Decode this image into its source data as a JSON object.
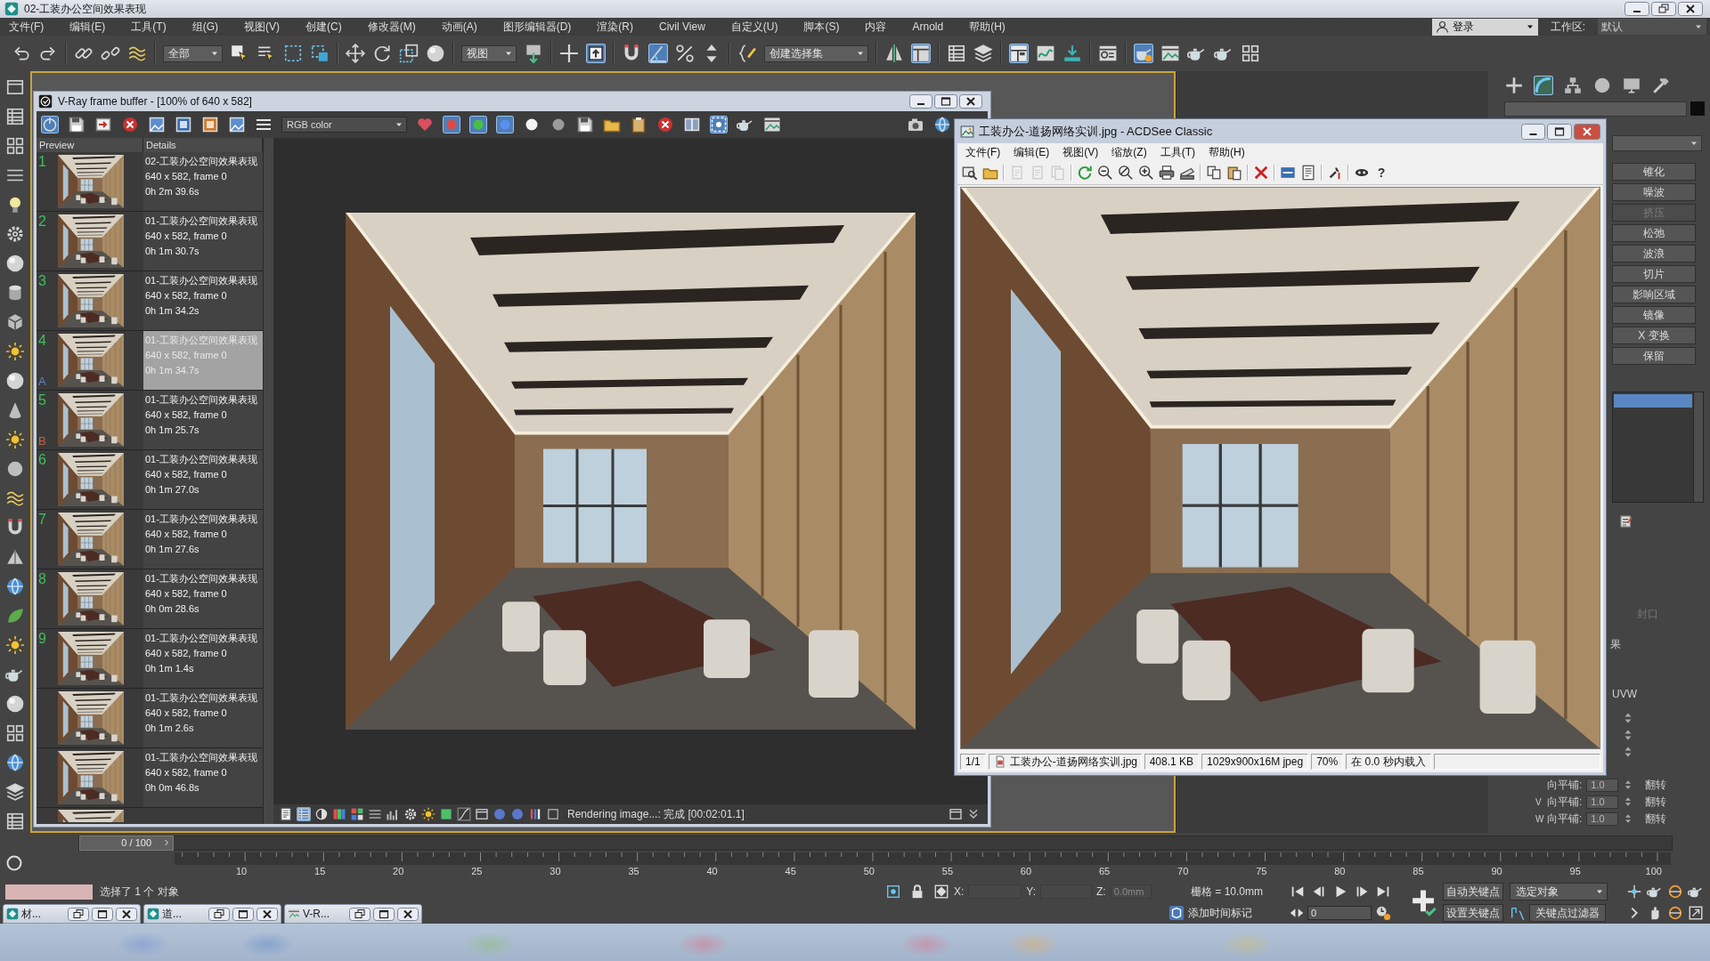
{
  "app": {
    "title": "02-工装办公空间效果表现"
  },
  "menu": [
    "文件(F)",
    "编辑(E)",
    "工具(T)",
    "组(G)",
    "视图(V)",
    "创建(C)",
    "修改器(M)",
    "动画(A)",
    "图形编辑器(D)",
    "渲染(R)",
    "Civil View",
    "自定义(U)",
    "脚本(S)",
    "内容",
    "Arnold",
    "帮助(H)"
  ],
  "account": {
    "label": "登录"
  },
  "workspace": {
    "label": "工作区:",
    "value": "默认"
  },
  "toolbar": {
    "items": [
      {
        "kind": "icon",
        "active": false
      },
      {
        "kind": "icon",
        "active": false
      },
      {
        "kind": "icon",
        "active": false
      },
      {
        "kind": "icon",
        "active": false
      },
      {
        "kind": "icon",
        "active": false
      },
      {
        "kind": "dropdown",
        "value": "全部"
      },
      {
        "kind": "icon",
        "active": false
      },
      {
        "kind": "icon",
        "active": false
      },
      {
        "kind": "icon",
        "active": false
      },
      {
        "kind": "icon",
        "active": false
      },
      {
        "kind": "icon",
        "active": false
      },
      {
        "kind": "icon",
        "active": false
      },
      {
        "kind": "icon",
        "active": false
      },
      {
        "kind": "icon",
        "active": false
      },
      {
        "kind": "dropdown",
        "value": "视图"
      },
      {
        "kind": "icon",
        "active": false
      },
      {
        "kind": "icon",
        "active": false
      },
      {
        "kind": "icon",
        "active": true
      },
      {
        "kind": "icon",
        "active": false
      },
      {
        "kind": "icon",
        "active": true
      },
      {
        "kind": "icon",
        "active": false
      },
      {
        "kind": "icon",
        "active": false
      },
      {
        "kind": "icon",
        "active": false
      },
      {
        "kind": "dropdown",
        "value": "创建选择集"
      },
      {
        "kind": "icon",
        "active": false
      },
      {
        "kind": "icon",
        "active": true
      },
      {
        "kind": "icon",
        "active": false
      },
      {
        "kind": "icon",
        "active": false
      },
      {
        "kind": "icon",
        "active": true
      },
      {
        "kind": "icon",
        "active": false
      },
      {
        "kind": "icon",
        "active": false
      },
      {
        "kind": "icon",
        "active": false
      },
      {
        "kind": "icon",
        "active": true
      },
      {
        "kind": "icon",
        "active": false
      },
      {
        "kind": "icon",
        "active": false
      },
      {
        "kind": "icon",
        "active": false
      },
      {
        "kind": "icon",
        "active": false
      }
    ]
  },
  "vray": {
    "title": "V-Ray frame buffer - [100% of 640 x 582]",
    "toolbar": [
      {
        "kind": "icon",
        "active": true
      },
      {
        "kind": "icon",
        "active": false
      },
      {
        "kind": "icon",
        "active": false
      },
      {
        "kind": "icon",
        "active": false
      },
      {
        "kind": "icon",
        "active": false
      },
      {
        "kind": "icon",
        "active": false
      },
      {
        "kind": "icon",
        "active": false
      },
      {
        "kind": "icon",
        "active": false
      },
      {
        "kind": "icon",
        "active": false
      },
      {
        "kind": "dropdown",
        "value": "RGB color"
      },
      {
        "kind": "icon",
        "active": false
      },
      {
        "kind": "icon",
        "active": true
      },
      {
        "kind": "icon",
        "active": true
      },
      {
        "kind": "icon",
        "active": true
      },
      {
        "kind": "icon",
        "active": false
      },
      {
        "kind": "icon",
        "active": false
      },
      {
        "kind": "icon",
        "active": false
      },
      {
        "kind": "icon",
        "active": false
      },
      {
        "kind": "icon",
        "active": false
      },
      {
        "kind": "icon",
        "active": false
      },
      {
        "kind": "icon",
        "active": false
      },
      {
        "kind": "icon",
        "active": true
      },
      {
        "kind": "icon",
        "active": false
      },
      {
        "kind": "icon",
        "active": false
      },
      {
        "kind": "icon",
        "active": false
      },
      {
        "kind": "icon",
        "active": false
      }
    ],
    "columns": [
      "Preview",
      "Details"
    ],
    "history": [
      {
        "number": "1",
        "name": "02-工装办公空间效果表现",
        "size": "640 x 582, frame 0",
        "time": "0h 2m 39.6s",
        "selected": false
      },
      {
        "number": "2",
        "name": "01-工装办公空间效果表现",
        "size": "640 x 582, frame 0",
        "time": "0h 1m 30.7s",
        "selected": false
      },
      {
        "number": "3",
        "name": "01-工装办公空间效果表现",
        "size": "640 x 582, frame 0",
        "time": "0h 1m 34.2s",
        "selected": false
      },
      {
        "number": "4",
        "name": "01-工装办公空间效果表现",
        "size": "640 x 582, frame 0",
        "time": "0h 1m 34.7s",
        "selected": true,
        "marker": "A"
      },
      {
        "number": "5",
        "name": "01-工装办公空间效果表现",
        "size": "640 x 582, frame 0",
        "time": "0h 1m 25.7s",
        "selected": false,
        "marker": "B"
      },
      {
        "number": "6",
        "name": "01-工装办公空间效果表现",
        "size": "640 x 582, frame 0",
        "time": "0h 1m 27.0s",
        "selected": false
      },
      {
        "number": "7",
        "name": "01-工装办公空间效果表现",
        "size": "640 x 582, frame 0",
        "time": "0h 1m 27.6s",
        "selected": false
      },
      {
        "number": "8",
        "name": "01-工装办公空间效果表现",
        "size": "640 x 582, frame 0",
        "time": "0h 0m 28.6s",
        "selected": false
      },
      {
        "number": "9",
        "name": "01-工装办公空间效果表现",
        "size": "640 x 582, frame 0",
        "time": "0h 1m 1.4s",
        "selected": false
      },
      {
        "name": "01-工装办公空间效果表现",
        "size": "640 x 582, frame 0",
        "time": "0h 1m 2.6s",
        "selected": false
      },
      {
        "name": "01-工装办公空间效果表现",
        "size": "640 x 582, frame 0",
        "time": "0h 0m 46.8s",
        "selected": false
      }
    ],
    "bottom_tools": [
      {
        "active": false
      },
      {
        "active": true
      },
      {
        "active": false
      },
      {
        "active": false
      },
      {
        "active": false
      },
      {
        "active": false
      },
      {
        "active": false
      },
      {
        "active": false
      },
      {
        "active": false
      },
      {
        "active": false
      },
      {
        "active": false
      },
      {
        "active": false
      },
      {
        "active": false
      },
      {
        "active": false
      },
      {
        "active": false
      },
      {
        "active": false
      },
      {
        "active": false
      },
      {
        "active": false
      }
    ],
    "status": "Rendering image...: 完成 [00:02:01.1]"
  },
  "acdsee": {
    "title": "工装办公-道扬网络实训.jpg - ACDSee Classic",
    "menu": [
      "文件(F)",
      "编辑(E)",
      "视图(V)",
      "缩放(Z)",
      "工具(T)",
      "帮助(H)"
    ],
    "toolbar": [
      {
        "kind": "icon",
        "disabled": false
      },
      {
        "kind": "icon",
        "disabled": false
      },
      {
        "kind": "icon",
        "disabled": true
      },
      {
        "kind": "icon",
        "disabled": true
      },
      {
        "kind": "icon",
        "disabled": true
      },
      {
        "kind": "icon",
        "disabled": false
      },
      {
        "kind": "icon",
        "disabled": false
      },
      {
        "kind": "icon",
        "disabled": false
      },
      {
        "kind": "icon",
        "disabled": false
      },
      {
        "kind": "icon",
        "disabled": false
      },
      {
        "kind": "icon",
        "disabled": false
      },
      {
        "kind": "icon",
        "disabled": false
      },
      {
        "kind": "icon",
        "disabled": false
      },
      {
        "kind": "icon",
        "disabled": false
      },
      {
        "kind": "icon",
        "disabled": false
      },
      {
        "kind": "icon",
        "disabled": false
      },
      {
        "kind": "icon",
        "disabled": false
      },
      {
        "kind": "icon",
        "disabled": false
      },
      {
        "kind": "label",
        "label": "?"
      }
    ],
    "status": {
      "index": "1/1",
      "file": "工装办公-道扬网络实训.jpg",
      "size": "408.1 KB",
      "format": "1029x900x16M jpeg",
      "zoom": "70%",
      "load_time": "在 0.0 秒内载入"
    }
  },
  "command_panel": {
    "tabs": [
      {
        "active": false
      },
      {
        "active": true
      },
      {
        "active": false
      },
      {
        "active": false
      },
      {
        "active": false
      },
      {
        "active": false
      }
    ],
    "modifier_buttons": [
      {
        "label": "锥化",
        "disabled": false
      },
      {
        "label": "噪波",
        "disabled": false
      },
      {
        "label": "挤压",
        "disabled": true
      },
      {
        "label": "松弛",
        "disabled": false
      },
      {
        "label": "波浪",
        "disabled": false
      },
      {
        "label": "切片",
        "disabled": false
      },
      {
        "label": "影响区域",
        "disabled": false
      },
      {
        "label": "镜像",
        "disabled": false
      },
      {
        "label": "X 变换",
        "disabled": false
      },
      {
        "label": "保留",
        "disabled": false
      }
    ],
    "cap": {
      "label": "封口",
      "disabled": true
    },
    "fragment": "果",
    "uvw": "UVW",
    "tiling": [
      {
        "label": "向平铺:",
        "value": "1.0",
        "flip": "翻转"
      },
      {
        "axis": "V",
        "label": "向平铺:",
        "value": "1.0",
        "flip": "翻转"
      },
      {
        "axis": "W",
        "label": "向平铺:",
        "value": "1.0",
        "flip": "翻转"
      }
    ]
  },
  "timeline": {
    "thumb": "0 / 100",
    "level": 0,
    "ticks": [
      "10",
      "15",
      "20",
      "25",
      "30",
      "35",
      "40",
      "45",
      "50",
      "55",
      "60",
      "65",
      "70",
      "75",
      "80",
      "85",
      "90",
      "95",
      "100"
    ]
  },
  "status": {
    "message": "选择了 1 个 对象",
    "coordinates": [
      {
        "axis": "X:",
        "disabled": true
      },
      {
        "axis": "Y:",
        "disabled": true
      },
      {
        "axis": "Z:",
        "value": "0.0mm",
        "disabled": true
      }
    ],
    "grid": "栅格 = 10.0mm",
    "time_tag": "添加时间标记",
    "frame": "0",
    "auto_key": "自动关键点",
    "set_key": "设置关键点",
    "key_target": "选定对象",
    "key_filters": "关键点过滤器"
  },
  "minimized_windows": [
    {
      "kind": "scene",
      "title": "材..."
    },
    {
      "kind": "scene",
      "title": "道..."
    },
    {
      "kind": "framebuffer",
      "title": "V-R..."
    }
  ]
}
